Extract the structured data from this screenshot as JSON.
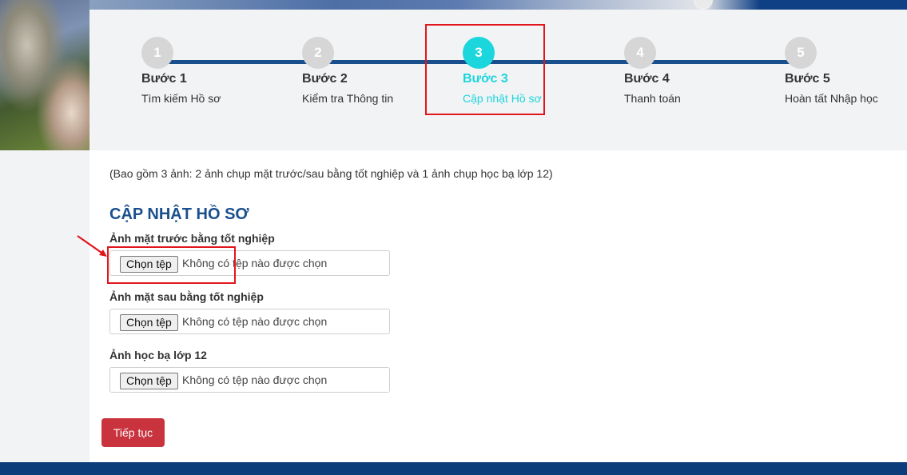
{
  "steps": [
    {
      "number": "1",
      "title": "Bước 1",
      "subtitle": "Tìm kiếm Hồ sơ"
    },
    {
      "number": "2",
      "title": "Bước 2",
      "subtitle": "Kiểm tra Thông tin"
    },
    {
      "number": "3",
      "title": "Bước 3",
      "subtitle": "Cập nhật Hồ sơ"
    },
    {
      "number": "4",
      "title": "Bước 4",
      "subtitle": "Thanh toán"
    },
    {
      "number": "5",
      "title": "Bước 5",
      "subtitle": "Hoàn tất Nhập học"
    }
  ],
  "active_step": 3,
  "form": {
    "note": "(Bao gồm 3 ảnh: 2 ảnh chụp mặt trước/sau bằng tốt nghiệp và 1 ảnh chụp học bạ lớp 12)",
    "title": "CẬP NHẬT HỒ SƠ",
    "fields": [
      {
        "label": "Ảnh mặt trước bằng tốt nghiệp",
        "button": "Chọn tệp",
        "status": "Không có tệp nào được chọn"
      },
      {
        "label": "Ảnh mặt sau bằng tốt nghiệp",
        "button": "Chọn tệp",
        "status": "Không có tệp nào được chọn"
      },
      {
        "label": "Ảnh học bạ lớp 12",
        "button": "Chọn tệp",
        "status": "Không có tệp nào được chọn"
      }
    ],
    "submit_label": "Tiếp tục"
  },
  "colors": {
    "primary": "#1a4f8e",
    "active_step": "#1bd6dc",
    "inactive_step": "#d6d6d6",
    "button": "#c8333d",
    "highlight": "#e1161d"
  }
}
